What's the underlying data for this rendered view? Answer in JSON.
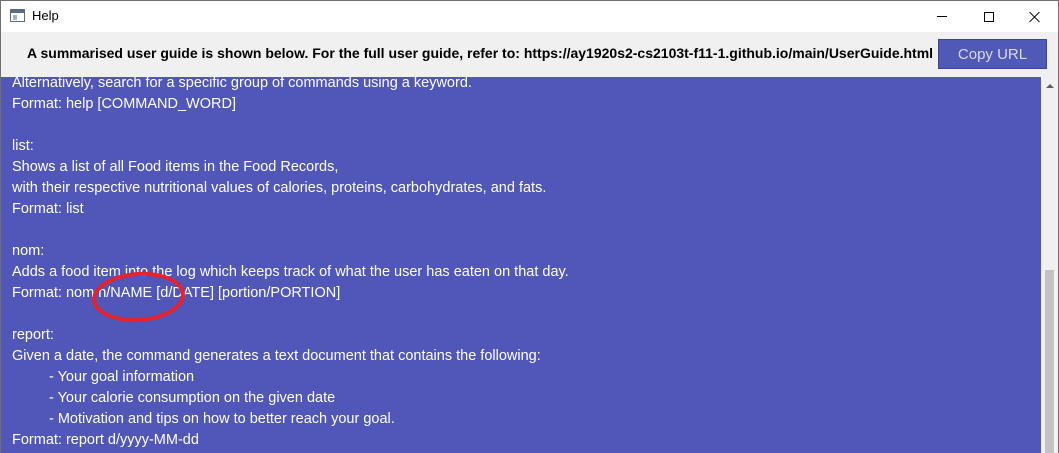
{
  "window": {
    "title": "Help",
    "icon": "app-window-icon"
  },
  "controls": {
    "minimize": "minimize-icon",
    "maximize": "maximize-icon",
    "close": "close-icon"
  },
  "header": {
    "message": "A summarised user guide is shown below. For the full user guide, refer to: https://ay1920s2-cs2103t-f11-1.github.io/main/UserGuide.html",
    "copy_button_label": "Copy URL"
  },
  "guide": {
    "help_desc": "Alternatively, search for a specific group of commands using a keyword.",
    "help_format": "Format: help [COMMAND_WORD]",
    "list_title": "list:",
    "list_desc1": "Shows a list of all Food items in the Food Records,",
    "list_desc2": "with their respective nutritional values of calories, proteins, carbohydrates, and fats.",
    "list_format": "Format: list",
    "nom_title": "nom:",
    "nom_desc": "Adds a food item into the log which keeps track of what the user has eaten on that day.",
    "nom_format": "Format: nom n/NAME [d/DATE] [portion/PORTION]",
    "report_title": "report:",
    "report_desc": "Given a date, the command generates a text document that contains the following:",
    "report_item1": "- Your goal information",
    "report_item2": "- Your calorie consumption on the given date",
    "report_item3": "- Motivation and tips on how to better reach your goal.",
    "report_format": "Format: report d/yyyy-MM-dd"
  },
  "colors": {
    "content_bg": "#5057b8",
    "button_bg": "#5059b5",
    "annotation": "#e8212b"
  }
}
